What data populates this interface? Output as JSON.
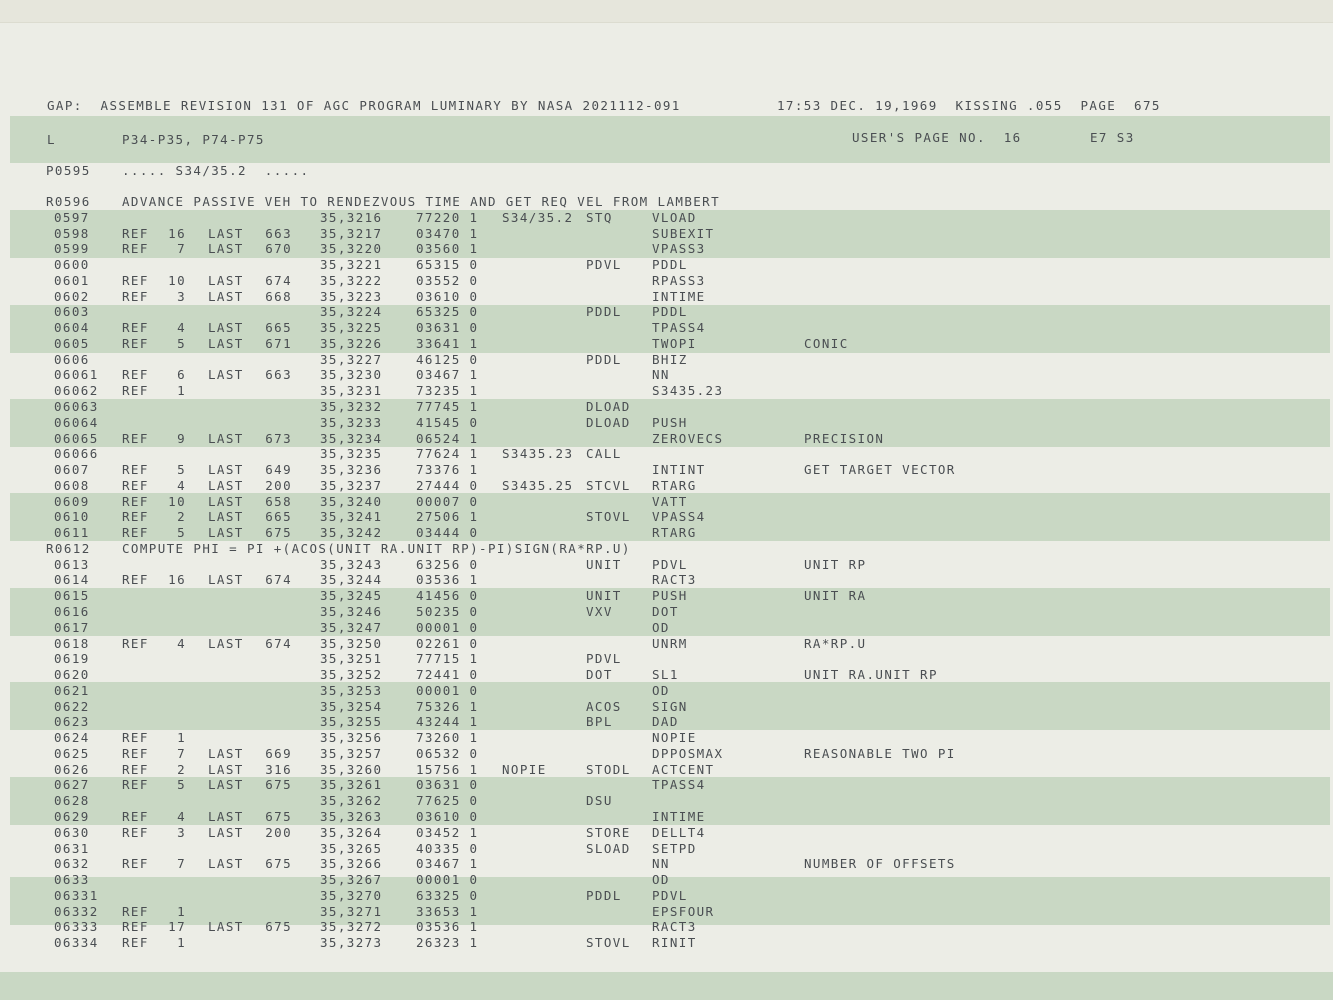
{
  "header": {
    "left": "GAP:  ASSEMBLE REVISION 131 OF AGC PROGRAM LUMINARY BY NASA 2021112-091",
    "right": "17:53 DEC. 19,1969  KISSING .055  PAGE  675"
  },
  "subheader": {
    "mark": "L",
    "title": "P34-P35, P74-P75",
    "page_label": "USER'S PAGE NO.  16",
    "code": "E7 S3"
  },
  "page_line": {
    "num": "P0595",
    "text": "..... S34/35.2  ....."
  },
  "rows": [
    {
      "type": "remark",
      "num": "R0596",
      "text": "ADVANCE PASSIVE VEH TO RENDEZVOUS TIME AND GET REQ VEL FROM LAMBERT"
    },
    {
      "num": "0597",
      "ref": "",
      "refn": "",
      "last": "",
      "lastn": "",
      "addr": "35,3216",
      "code": "77220 1",
      "label": "S34/35.2",
      "op": "STQ",
      "operand": "VLOAD",
      "comment": ""
    },
    {
      "num": "0598",
      "ref": "REF",
      "refn": "16",
      "last": "LAST",
      "lastn": "663",
      "addr": "35,3217",
      "code": "03470 1",
      "label": "",
      "op": "",
      "operand": "SUBEXIT",
      "comment": ""
    },
    {
      "num": "0599",
      "ref": "REF",
      "refn": "7",
      "last": "LAST",
      "lastn": "670",
      "addr": "35,3220",
      "code": "03560 1",
      "label": "",
      "op": "",
      "operand": "VPASS3",
      "comment": ""
    },
    {
      "num": "0600",
      "ref": "",
      "refn": "",
      "last": "",
      "lastn": "",
      "addr": "35,3221",
      "code": "65315 0",
      "label": "",
      "op": "PDVL",
      "operand": "PDDL",
      "comment": ""
    },
    {
      "num": "0601",
      "ref": "REF",
      "refn": "10",
      "last": "LAST",
      "lastn": "674",
      "addr": "35,3222",
      "code": "03552 0",
      "label": "",
      "op": "",
      "operand": "RPASS3",
      "comment": ""
    },
    {
      "num": "0602",
      "ref": "REF",
      "refn": "3",
      "last": "LAST",
      "lastn": "668",
      "addr": "35,3223",
      "code": "03610 0",
      "label": "",
      "op": "",
      "operand": "INTIME",
      "comment": ""
    },
    {
      "num": "0603",
      "ref": "",
      "refn": "",
      "last": "",
      "lastn": "",
      "addr": "35,3224",
      "code": "65325 0",
      "label": "",
      "op": "PDDL",
      "operand": "PDDL",
      "comment": ""
    },
    {
      "num": "0604",
      "ref": "REF",
      "refn": "4",
      "last": "LAST",
      "lastn": "665",
      "addr": "35,3225",
      "code": "03631 0",
      "label": "",
      "op": "",
      "operand": "TPASS4",
      "comment": ""
    },
    {
      "num": "0605",
      "ref": "REF",
      "refn": "5",
      "last": "LAST",
      "lastn": "671",
      "addr": "35,3226",
      "code": "33641 1",
      "label": "",
      "op": "",
      "operand": "TWOPI",
      "comment": "CONIC"
    },
    {
      "num": "0606",
      "ref": "",
      "refn": "",
      "last": "",
      "lastn": "",
      "addr": "35,3227",
      "code": "46125 0",
      "label": "",
      "op": "PDDL",
      "operand": "BHIZ",
      "comment": ""
    },
    {
      "num": "06061",
      "ref": "REF",
      "refn": "6",
      "last": "LAST",
      "lastn": "663",
      "addr": "35,3230",
      "code": "03467 1",
      "label": "",
      "op": "",
      "operand": "NN",
      "comment": ""
    },
    {
      "num": "06062",
      "ref": "REF",
      "refn": "1",
      "last": "",
      "lastn": "",
      "addr": "35,3231",
      "code": "73235 1",
      "label": "",
      "op": "",
      "operand": "S3435.23",
      "comment": ""
    },
    {
      "num": "06063",
      "ref": "",
      "refn": "",
      "last": "",
      "lastn": "",
      "addr": "35,3232",
      "code": "77745 1",
      "label": "",
      "op": "DLOAD",
      "operand": "",
      "comment": ""
    },
    {
      "num": "06064",
      "ref": "",
      "refn": "",
      "last": "",
      "lastn": "",
      "addr": "35,3233",
      "code": "41545 0",
      "label": "",
      "op": "DLOAD",
      "operand": "PUSH",
      "comment": ""
    },
    {
      "num": "06065",
      "ref": "REF",
      "refn": "9",
      "last": "LAST",
      "lastn": "673",
      "addr": "35,3234",
      "code": "06524 1",
      "label": "",
      "op": "",
      "operand": "ZEROVECS",
      "comment": "PRECISION"
    },
    {
      "num": "06066",
      "ref": "",
      "refn": "",
      "last": "",
      "lastn": "",
      "addr": "35,3235",
      "code": "77624 1",
      "label": "S3435.23",
      "op": "CALL",
      "operand": "",
      "comment": ""
    },
    {
      "num": "0607",
      "ref": "REF",
      "refn": "5",
      "last": "LAST",
      "lastn": "649",
      "addr": "35,3236",
      "code": "73376 1",
      "label": "",
      "op": "",
      "operand": "INTINT",
      "comment": "GET TARGET VECTOR"
    },
    {
      "num": "0608",
      "ref": "REF",
      "refn": "4",
      "last": "LAST",
      "lastn": "200",
      "addr": "35,3237",
      "code": "27444 0",
      "label": "S3435.25",
      "op": "STCVL",
      "operand": "RTARG",
      "comment": ""
    },
    {
      "num": "0609",
      "ref": "REF",
      "refn": "10",
      "last": "LAST",
      "lastn": "658",
      "addr": "35,3240",
      "code": "00007 0",
      "label": "",
      "op": "",
      "operand": "VATT",
      "comment": ""
    },
    {
      "num": "0610",
      "ref": "REF",
      "refn": "2",
      "last": "LAST",
      "lastn": "665",
      "addr": "35,3241",
      "code": "27506 1",
      "label": "",
      "op": "STOVL",
      "operand": "VPASS4",
      "comment": ""
    },
    {
      "num": "0611",
      "ref": "REF",
      "refn": "5",
      "last": "LAST",
      "lastn": "675",
      "addr": "35,3242",
      "code": "03444 0",
      "label": "",
      "op": "",
      "operand": "RTARG",
      "comment": ""
    },
    {
      "type": "remark",
      "num": "R0612",
      "text": "COMPUTE PHI = PI +(ACOS(UNIT RA.UNIT RP)-PI)SIGN(RA*RP.U)"
    },
    {
      "num": "0613",
      "ref": "",
      "refn": "",
      "last": "",
      "lastn": "",
      "addr": "35,3243",
      "code": "63256 0",
      "label": "",
      "op": "UNIT",
      "operand": "PDVL",
      "comment": "UNIT RP"
    },
    {
      "num": "0614",
      "ref": "REF",
      "refn": "16",
      "last": "LAST",
      "lastn": "674",
      "addr": "35,3244",
      "code": "03536 1",
      "label": "",
      "op": "",
      "operand": "RACT3",
      "comment": ""
    },
    {
      "num": "0615",
      "ref": "",
      "refn": "",
      "last": "",
      "lastn": "",
      "addr": "35,3245",
      "code": "41456 0",
      "label": "",
      "op": "UNIT",
      "operand": "PUSH",
      "comment": "UNIT RA"
    },
    {
      "num": "0616",
      "ref": "",
      "refn": "",
      "last": "",
      "lastn": "",
      "addr": "35,3246",
      "code": "50235 0",
      "label": "",
      "op": "VXV",
      "operand": "DOT",
      "comment": ""
    },
    {
      "num": "0617",
      "ref": "",
      "refn": "",
      "last": "",
      "lastn": "",
      "addr": "35,3247",
      "code": "00001 0",
      "label": "",
      "op": "",
      "operand": "OD",
      "comment": ""
    },
    {
      "num": "0618",
      "ref": "REF",
      "refn": "4",
      "last": "LAST",
      "lastn": "674",
      "addr": "35,3250",
      "code": "02261 0",
      "label": "",
      "op": "",
      "operand": "UNRM",
      "comment": "RA*RP.U"
    },
    {
      "num": "0619",
      "ref": "",
      "refn": "",
      "last": "",
      "lastn": "",
      "addr": "35,3251",
      "code": "77715 1",
      "label": "",
      "op": "PDVL",
      "operand": "",
      "comment": ""
    },
    {
      "num": "0620",
      "ref": "",
      "refn": "",
      "last": "",
      "lastn": "",
      "addr": "35,3252",
      "code": "72441 0",
      "label": "",
      "op": "DOT",
      "operand": "SL1",
      "comment": "UNIT RA.UNIT RP"
    },
    {
      "num": "0621",
      "ref": "",
      "refn": "",
      "last": "",
      "lastn": "",
      "addr": "35,3253",
      "code": "00001 0",
      "label": "",
      "op": "",
      "operand": "OD",
      "comment": ""
    },
    {
      "num": "0622",
      "ref": "",
      "refn": "",
      "last": "",
      "lastn": "",
      "addr": "35,3254",
      "code": "75326 1",
      "label": "",
      "op": "ACOS",
      "operand": "SIGN",
      "comment": ""
    },
    {
      "num": "0623",
      "ref": "",
      "refn": "",
      "last": "",
      "lastn": "",
      "addr": "35,3255",
      "code": "43244 1",
      "label": "",
      "op": "BPL",
      "operand": "DAD",
      "comment": ""
    },
    {
      "num": "0624",
      "ref": "REF",
      "refn": "1",
      "last": "",
      "lastn": "",
      "addr": "35,3256",
      "code": "73260 1",
      "label": "",
      "op": "",
      "operand": "NOPIE",
      "comment": ""
    },
    {
      "num": "0625",
      "ref": "REF",
      "refn": "7",
      "last": "LAST",
      "lastn": "669",
      "addr": "35,3257",
      "code": "06532 0",
      "label": "",
      "op": "",
      "operand": "DPPOSMAX",
      "comment": "REASONABLE TWO PI"
    },
    {
      "num": "0626",
      "ref": "REF",
      "refn": "2",
      "last": "LAST",
      "lastn": "316",
      "addr": "35,3260",
      "code": "15756 1",
      "label": "NOPIE",
      "op": "STODL",
      "operand": "ACTCENT",
      "comment": ""
    },
    {
      "num": "0627",
      "ref": "REF",
      "refn": "5",
      "last": "LAST",
      "lastn": "675",
      "addr": "35,3261",
      "code": "03631 0",
      "label": "",
      "op": "",
      "operand": "TPASS4",
      "comment": ""
    },
    {
      "num": "0628",
      "ref": "",
      "refn": "",
      "last": "",
      "lastn": "",
      "addr": "35,3262",
      "code": "77625 0",
      "label": "",
      "op": "DSU",
      "operand": "",
      "comment": ""
    },
    {
      "num": "0629",
      "ref": "REF",
      "refn": "4",
      "last": "LAST",
      "lastn": "675",
      "addr": "35,3263",
      "code": "03610 0",
      "label": "",
      "op": "",
      "operand": "INTIME",
      "comment": ""
    },
    {
      "num": "0630",
      "ref": "REF",
      "refn": "3",
      "last": "LAST",
      "lastn": "200",
      "addr": "35,3264",
      "code": "03452 1",
      "label": "",
      "op": "STORE",
      "operand": "DELLT4",
      "comment": ""
    },
    {
      "num": "0631",
      "ref": "",
      "refn": "",
      "last": "",
      "lastn": "",
      "addr": "35,3265",
      "code": "40335 0",
      "label": "",
      "op": "SLOAD",
      "operand": "SETPD",
      "comment": ""
    },
    {
      "num": "0632",
      "ref": "REF",
      "refn": "7",
      "last": "LAST",
      "lastn": "675",
      "addr": "35,3266",
      "code": "03467 1",
      "label": "",
      "op": "",
      "operand": "NN",
      "comment": "NUMBER OF OFFSETS"
    },
    {
      "num": "0633",
      "ref": "",
      "refn": "",
      "last": "",
      "lastn": "",
      "addr": "35,3267",
      "code": "00001 0",
      "label": "",
      "op": "",
      "operand": "OD",
      "comment": ""
    },
    {
      "num": "06331",
      "ref": "",
      "refn": "",
      "last": "",
      "lastn": "",
      "addr": "35,3270",
      "code": "63325 0",
      "label": "",
      "op": "PDDL",
      "operand": "PDVL",
      "comment": ""
    },
    {
      "num": "06332",
      "ref": "REF",
      "refn": "1",
      "last": "",
      "lastn": "",
      "addr": "35,3271",
      "code": "33653 1",
      "label": "",
      "op": "",
      "operand": "EPSFOUR",
      "comment": ""
    },
    {
      "num": "06333",
      "ref": "REF",
      "refn": "17",
      "last": "LAST",
      "lastn": "675",
      "addr": "35,3272",
      "code": "03536 1",
      "label": "",
      "op": "",
      "operand": "RACT3",
      "comment": ""
    },
    {
      "num": "06334",
      "ref": "REF",
      "refn": "1",
      "last": "",
      "lastn": "",
      "addr": "35,3273",
      "code": "26323 1",
      "label": "",
      "op": "STOVL",
      "operand": "RINIT",
      "comment": ""
    }
  ]
}
